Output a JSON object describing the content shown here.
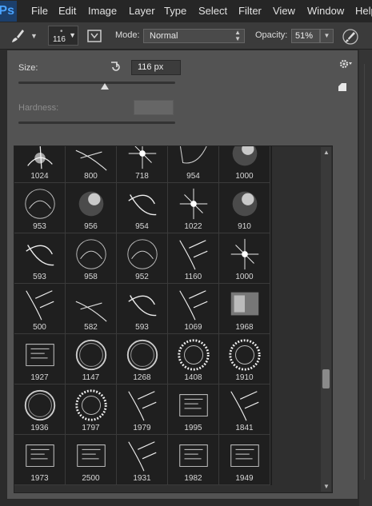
{
  "menubar": {
    "logo": "Ps",
    "items": [
      "File",
      "Edit",
      "Image",
      "Layer",
      "Type",
      "Select",
      "Filter",
      "View",
      "Window",
      "Help"
    ]
  },
  "options": {
    "tool_icon": "brush-icon",
    "brush_preset_size": "116",
    "mode_label": "Mode:",
    "mode_value": "Normal",
    "opacity_label": "Opacity:",
    "opacity_value": "51%"
  },
  "popup": {
    "size_label": "Size:",
    "size_value": "116 px",
    "size_slider_fraction": 0.55,
    "hardness_label": "Hardness:"
  },
  "brushes": [
    [
      "1024",
      "800",
      "718",
      "954",
      "1000"
    ],
    [
      "953",
      "956",
      "954",
      "1022",
      "910"
    ],
    [
      "593",
      "958",
      "952",
      "1160",
      "1000"
    ],
    [
      "500",
      "582",
      "593",
      "1069",
      "1968"
    ],
    [
      "1927",
      "1147",
      "1268",
      "1408",
      "1910"
    ],
    [
      "1936",
      "1797",
      "1979",
      "1995",
      "1841"
    ],
    [
      "1973",
      "2500",
      "1931",
      "1982",
      "1949"
    ]
  ],
  "colors": {
    "menubar_bg": "#262626",
    "optbar_bg": "#3b3b3b",
    "popup_bg": "#535353",
    "ps_blue": "#4aa3ff"
  }
}
